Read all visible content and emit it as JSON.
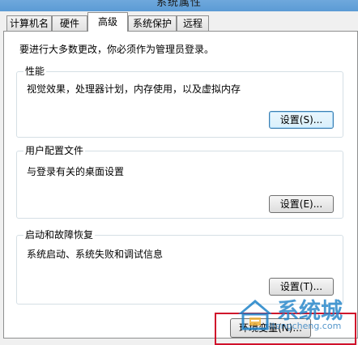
{
  "window": {
    "title": "系统属性"
  },
  "tabs": [
    {
      "label": "计算机名"
    },
    {
      "label": "硬件"
    },
    {
      "label": "高级"
    },
    {
      "label": "系统保护"
    },
    {
      "label": "远程"
    }
  ],
  "notice": "要进行大多数更改，你必须作为管理员登录。",
  "performance": {
    "title": "性能",
    "description": "视觉效果，处理器计划，内存使用，以及虚拟内存",
    "button": "设置(S)..."
  },
  "user_profiles": {
    "title": "用户配置文件",
    "description": "与登录有关的桌面设置",
    "button": "设置(E)..."
  },
  "startup_recovery": {
    "title": "启动和故障恢复",
    "description": "系统启动、系统失败和调试信息",
    "button": "设置(T)..."
  },
  "env_button": "环境变量(N)...",
  "watermark": {
    "text": "系统城",
    "url": "xitongcheng.com"
  },
  "colors": {
    "accent": "#3c7fb1",
    "highlight": "#d0112b",
    "watermark": "#1e82c8"
  }
}
